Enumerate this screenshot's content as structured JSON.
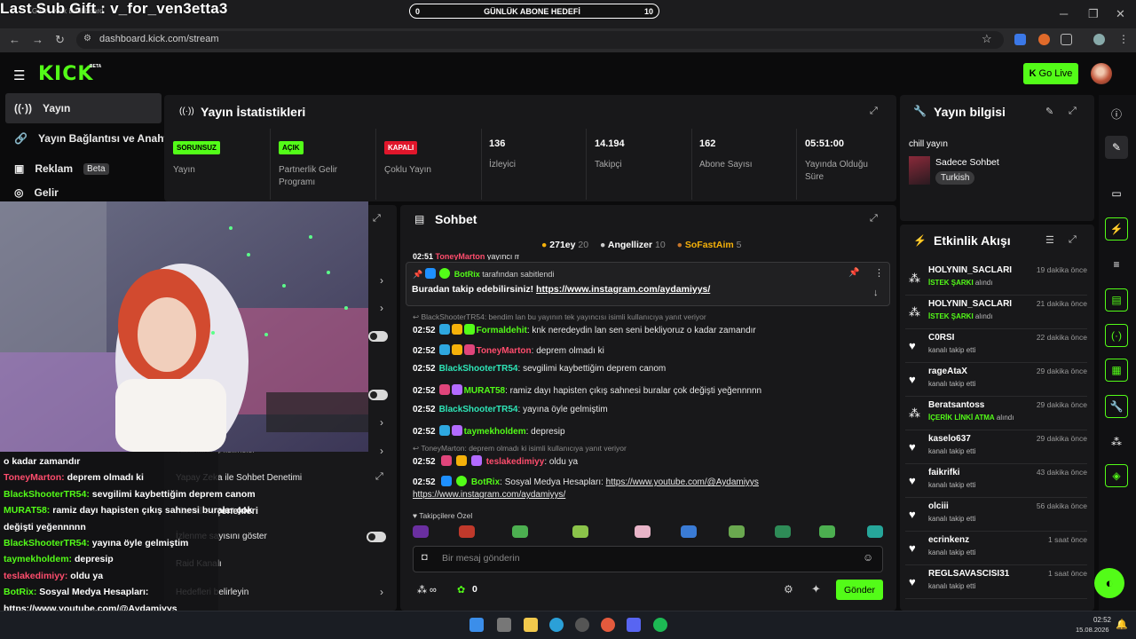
{
  "stream_overlay": {
    "sub_gift": "Last Sub Gift : v_for_ven3etta3",
    "goal_left": "0",
    "goal_label": "GÜNLÜK ABONE HEDEFİ",
    "goal_right": "10"
  },
  "browser": {
    "url": "dashboard.kick.com/stream"
  },
  "header": {
    "logo": "KICK",
    "beta": "BETA",
    "go_live": "Go Live"
  },
  "sidebar": {
    "items": [
      {
        "label": "Yayın",
        "icon": "broadcast-icon"
      },
      {
        "label": "Yayın Bağlantısı ve Anahtar",
        "icon": "link-icon"
      },
      {
        "label": "Reklam",
        "icon": "ad-icon",
        "badge": "Beta"
      },
      {
        "label": "Gelir",
        "icon": "revenue-icon"
      }
    ]
  },
  "stats": {
    "title": "Yayın İstatistikleri",
    "boxes": [
      {
        "badge": "SORUNSUZ",
        "badge_color": "#53fc18",
        "label": "Yayın"
      },
      {
        "badge": "AÇIK",
        "badge_color": "#53fc18",
        "label": "Partnerlik Gelir Programı"
      },
      {
        "badge": "KAPALI",
        "badge_color": "#e0162b",
        "label": "Çoklu Yayın"
      },
      {
        "value": "136",
        "label": "İzleyici"
      },
      {
        "value": "14.194",
        "label": "Takipçi"
      },
      {
        "value": "162",
        "label": "Abone Sayısı"
      },
      {
        "value": "05:51:00",
        "label": "Yayında Olduğu Süre"
      }
    ]
  },
  "stream_info": {
    "title": "Yayın bilgisi",
    "stream_title": "chill yayın",
    "category": "Sadece Sohbet",
    "tag": "Turkish"
  },
  "chat": {
    "title": "Sohbet",
    "top_gifters": [
      {
        "name": "271ey",
        "count": "20"
      },
      {
        "name": "Angellizer",
        "count": "10"
      },
      {
        "name": "SoFastAim",
        "count": "5"
      }
    ],
    "partial_top": "02:51",
    "partial_user": "ToneyMarton",
    "partial_text": "yayıncı mı",
    "pinned_by": "BotRix",
    "pinned_suffix": "tarafından sabitlendi",
    "pinned_text": "Buradan takip edebilirsiniz!",
    "pinned_link": "https://www.instagram.com/aydamiyys/",
    "reply1": "BlackShooterTR54: bendim lan bu yayının tek yayıncısı isimli kullanıcıya yanıt veriyor",
    "messages": [
      {
        "time": "02:52",
        "user": "Formaldehit",
        "text": "knk neredeydin lan sen seni bekliyoruz o kadar zamandır",
        "color": "#53fc18"
      },
      {
        "time": "02:52",
        "user": "ToneyMarton",
        "text": "deprem olmadı ki",
        "color": "#ff4d6d"
      },
      {
        "time": "02:52",
        "user": "BlackShooterTR54",
        "text": "sevgilimi kaybettiğim deprem canom",
        "color": "#2ee6b8"
      },
      {
        "time": "02:52",
        "user": "MURAT58",
        "text": "ramiz dayı hapisten çıkış sahnesi buralar çok değişti yeğennnnn",
        "color": "#53fc18"
      },
      {
        "time": "02:52",
        "user": "BlackShooterTR54",
        "text": "yayına öyle gelmiştim",
        "color": "#2ee6b8"
      },
      {
        "time": "02:52",
        "user": "taymekholdem",
        "text": "depresip",
        "color": "#53fc18"
      }
    ],
    "reply2": "ToneyMarton: deprem olmadı ki isimli kullanıcıya yanıt veriyor",
    "msg_teslake": {
      "time": "02:52",
      "user": "teslakedimiyy",
      "text": "oldu ya"
    },
    "msg_botrix": {
      "time": "02:52",
      "user": "BotRix",
      "text": "Sosyal Medya Hesapları:",
      "link1": "https://www.youtube.com/@Aydamiyys",
      "link2": "https://www.instagram.com/aydamiyys/"
    },
    "followers_only": "Takipçilere Özel",
    "input_placeholder": "Bir mesaj gönderin",
    "points": "0",
    "send": "Gönder"
  },
  "activity": {
    "title": "Etkinlik Akışı",
    "items": [
      {
        "name": "HOLYNIN_SACLARI",
        "highlight": "İSTEK ŞARKI",
        "sub": "alındı",
        "time": "19 dakika önce",
        "icon": "redeem-icon"
      },
      {
        "name": "HOLYNIN_SACLARI",
        "highlight": "İSTEK ŞARKI",
        "sub": "alındı",
        "time": "21 dakika önce",
        "icon": "redeem-icon"
      },
      {
        "name": "C0RSI",
        "highlight": "",
        "sub": "kanalı takip etti",
        "time": "22 dakika önce",
        "icon": "heart-icon"
      },
      {
        "name": "rageAtaX",
        "highlight": "",
        "sub": "kanalı takip etti",
        "time": "29 dakika önce",
        "icon": "heart-icon"
      },
      {
        "name": "Beratsantoss",
        "highlight": "İÇERİK LİNKİ ATMA",
        "sub": "alındı",
        "time": "29 dakika önce",
        "icon": "redeem-icon"
      },
      {
        "name": "kaselo637",
        "highlight": "",
        "sub": "kanalı takip etti",
        "time": "29 dakika önce",
        "icon": "heart-icon"
      },
      {
        "name": "faikrifki",
        "highlight": "",
        "sub": "kanalı takip etti",
        "time": "43 dakika önce",
        "icon": "heart-icon"
      },
      {
        "name": "olciii",
        "highlight": "",
        "sub": "kanalı takip etti",
        "time": "56 dakika önce",
        "icon": "heart-icon"
      },
      {
        "name": "ecrinkenz",
        "highlight": "",
        "sub": "kanalı takip etti",
        "time": "1 saat önce",
        "icon": "heart-icon"
      },
      {
        "name": "REGLSAVASCISI31",
        "highlight": "",
        "sub": "kanalı takip etti",
        "time": "1 saat önce",
        "icon": "heart-icon"
      }
    ]
  },
  "settings": {
    "ai_moderation": "Yapay Zeka ile Sohbet Denetimi",
    "channel_options": "Kanal seçenekleri",
    "show_viewcount": "İzlenme sayısını göster",
    "raid": "Raid Kanalı",
    "goals": "Hedefleri belirleyin",
    "partial_row": "Yasaklanmış kelimeler"
  },
  "overlay_chat": [
    {
      "user": "",
      "text": "o kadar zamandır",
      "color": "#ffffff"
    },
    {
      "user": "ToneyMarton:",
      "text": "deprem olmadı ki",
      "color": "#ff4d6d"
    },
    {
      "user": "BlackShooterTR54:",
      "text": "sevgilimi kaybettiğim deprem canom",
      "color": "#53fc18"
    },
    {
      "user": "MURAT58:",
      "text": "ramiz dayı hapisten çıkış sahnesi buralar çok",
      "color": "#53fc18"
    },
    {
      "user": "",
      "text": "değişti yeğennnnn",
      "color": "#ffffff"
    },
    {
      "user": "BlackShooterTR54:",
      "text": "yayına öyle gelmiştim",
      "color": "#53fc18"
    },
    {
      "user": "taymekholdem:",
      "text": "depresip",
      "color": "#53fc18"
    },
    {
      "user": "teslakedimiyy:",
      "text": "oldu ya",
      "color": "#ff4d6d"
    },
    {
      "user": "BotRix:",
      "text": "Sosyal Medya Hesapları:",
      "color": "#53fc18"
    },
    {
      "user": "",
      "text": "https://www.youtube.com/@Aydamiyys",
      "color": "#ffffff"
    },
    {
      "user": "",
      "text": "https://www.instagram.com/aydamiyys/",
      "color": "#ffffff"
    }
  ],
  "taskbar": {
    "time": "02:52",
    "date": "15.08.2026"
  }
}
